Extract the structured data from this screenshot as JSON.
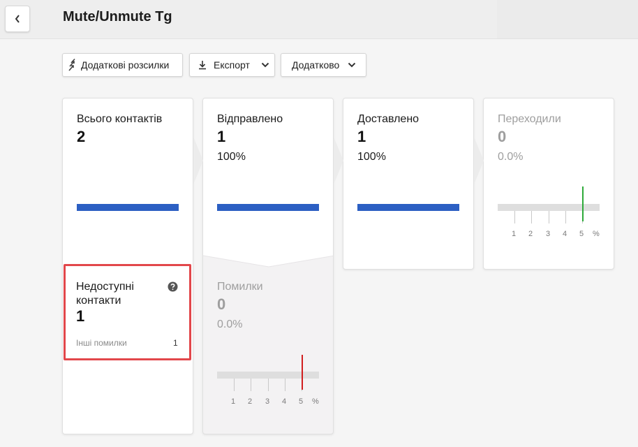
{
  "header": {
    "title": "Mute/Unmute Tg"
  },
  "toolbar": {
    "extra_mailings_label": "Додаткові розсилки",
    "export_label": "Експорт",
    "more_label": "Додатково"
  },
  "cards": {
    "total": {
      "label": "Всього контактів",
      "value": "2"
    },
    "sent": {
      "label": "Відправлено",
      "value": "1",
      "percent": "100%"
    },
    "delivered": {
      "label": "Доставлено",
      "value": "1",
      "percent": "100%"
    },
    "clicked": {
      "label": "Переходили",
      "value": "0",
      "percent": "0.0%",
      "scale": [
        "1",
        "2",
        "3",
        "4",
        "5",
        "%"
      ]
    },
    "unavailable": {
      "label": "Недоступні контакти",
      "value": "1",
      "other_errors_label": "Інші помилки",
      "other_errors_value": "1"
    },
    "errors": {
      "label": "Помилки",
      "value": "0",
      "percent": "0.0%",
      "scale": [
        "1",
        "2",
        "3",
        "4",
        "5",
        "%"
      ]
    }
  },
  "icons": {
    "back": "chevron-left-icon",
    "extra": "arrows-icon",
    "export": "download-icon",
    "dropdown": "chevron-down-icon",
    "help": "question-circle-icon"
  },
  "colors": {
    "progress_blue": "#2c5fc3",
    "clicked_marker": "#2eaa3a",
    "errors_marker": "#d11e1e",
    "highlight_border": "#e2474b"
  }
}
